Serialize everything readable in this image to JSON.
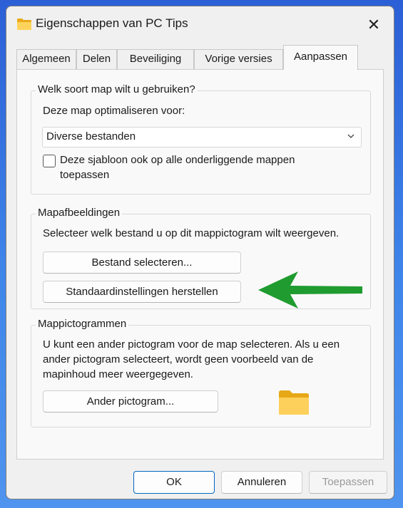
{
  "window": {
    "title": "Eigenschappen van PC Tips",
    "close_glyph": "✕",
    "title_icon": "folder-icon"
  },
  "tabs": [
    {
      "label": "Algemeen",
      "active": false
    },
    {
      "label": "Delen",
      "active": false
    },
    {
      "label": "Beveiliging",
      "active": false
    },
    {
      "label": "Vorige versies",
      "active": false
    },
    {
      "label": "Aanpassen",
      "active": true
    }
  ],
  "folder_type": {
    "group_label": "Welk soort map wilt u gebruiken?",
    "optimize_label": "Deze map optimaliseren voor:",
    "select_value": "Diverse bestanden",
    "checkbox_line1": "Deze sjabloon ook op alle onderliggende mappen",
    "checkbox_line2": "toepassen",
    "checkbox_checked": false
  },
  "folder_pictures": {
    "group_label": "Mapafbeeldingen",
    "description": "Selecteer welk bestand u op dit mappictogram wilt weergeven.",
    "choose_file_label": "Bestand selecteren...",
    "restore_default_label": "Standaardinstellingen herstellen",
    "annotation_arrow_color": "#1f9b30"
  },
  "folder_icons": {
    "group_label": "Mappictogrammen",
    "description_line1": "U kunt een ander pictogram voor de map selecteren. Als u een",
    "description_line2": "ander pictogram selecteert, wordt geen voorbeeld van de",
    "description_line3": "mapinhoud meer weergegeven.",
    "change_icon_label": "Ander pictogram..."
  },
  "footer": {
    "ok_label": "OK",
    "cancel_label": "Annuleren",
    "apply_label": "Toepassen",
    "apply_enabled": false
  },
  "colors": {
    "accent": "#0067c0",
    "folder_yellow": "#f8c942"
  }
}
